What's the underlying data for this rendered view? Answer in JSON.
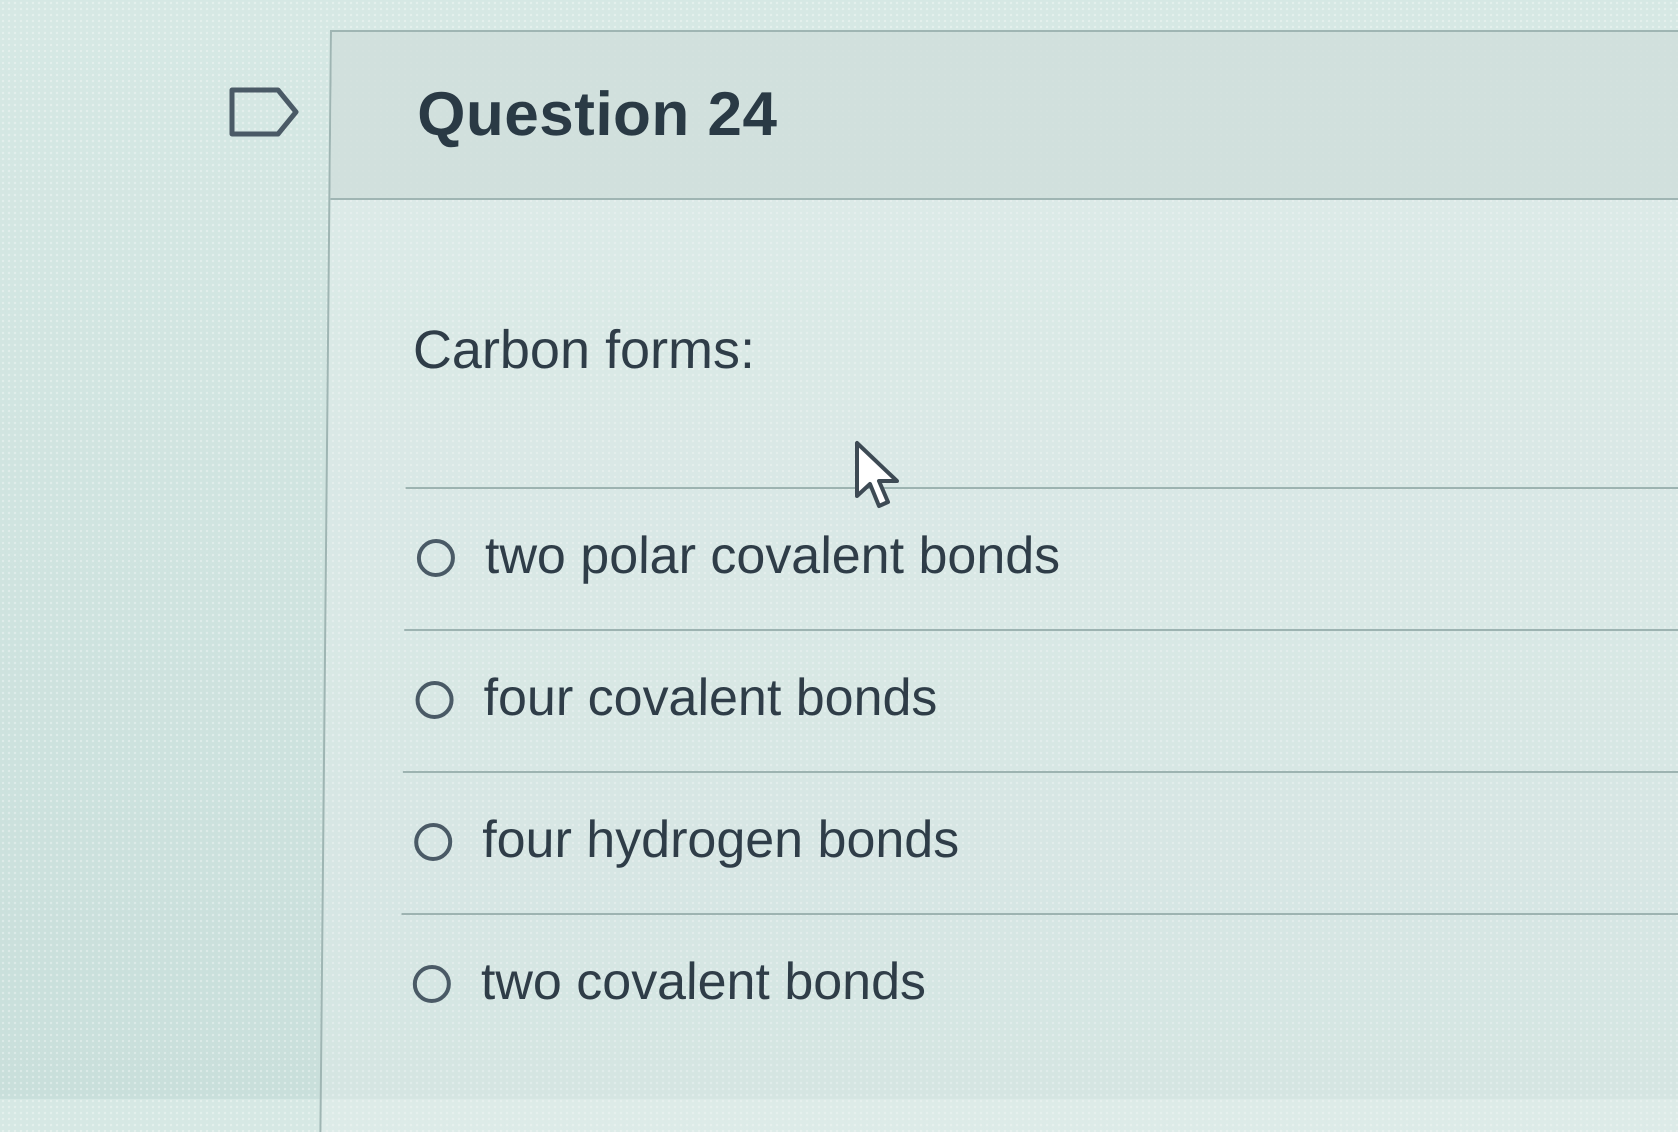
{
  "question": {
    "title": "Question 24",
    "prompt": "Carbon forms:",
    "answers": [
      {
        "label": "two polar covalent bonds",
        "selected": false
      },
      {
        "label": "four covalent bonds",
        "selected": false
      },
      {
        "label": "four hydrogen bonds",
        "selected": false
      },
      {
        "label": "two covalent bonds",
        "selected": false
      }
    ]
  },
  "icons": {
    "flag": "flag-outline-icon",
    "cursor": "mouse-pointer-icon"
  },
  "colors": {
    "text": "#2d3b45",
    "border": "#9fb5b3",
    "header_background": "#cfdedb"
  }
}
